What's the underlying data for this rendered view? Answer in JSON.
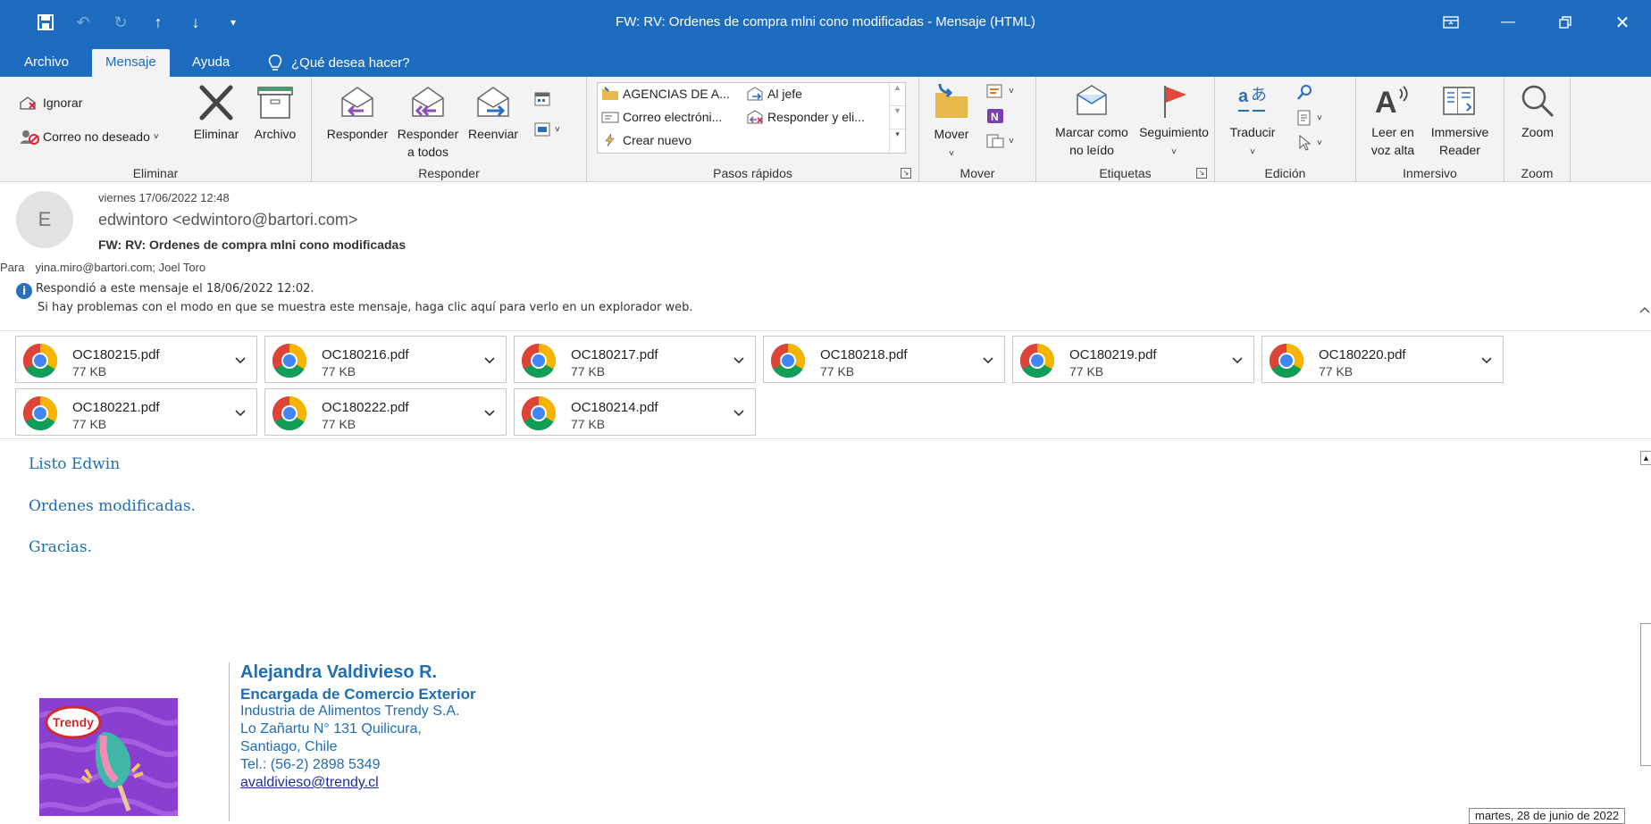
{
  "titlebar": {
    "title": "FW: RV: Ordenes de compra mlni cono  modificadas  -  Mensaje (HTML)"
  },
  "tabs": [
    {
      "label": "Archivo"
    },
    {
      "label": "Mensaje"
    },
    {
      "label": "Ayuda"
    }
  ],
  "tellme": {
    "label": "¿Qué desea hacer?"
  },
  "ribbon": {
    "eliminar": {
      "ignore": "Ignorar",
      "junk": "Correo no deseado",
      "delete": "Eliminar",
      "archive": "Archivo",
      "group": "Eliminar"
    },
    "responder": {
      "reply": "Responder",
      "reply_all_1": "Responder",
      "reply_all_2": "a todos",
      "forward": "Reenviar",
      "group": "Responder"
    },
    "quicksteps": {
      "item1": "AGENCIAS DE A...",
      "item2": "Al jefe",
      "item3": "Correo electróni...",
      "item4": "Responder y eli...",
      "item5": "Crear nuevo",
      "group": "Pasos rápidos"
    },
    "mover": {
      "move": "Mover",
      "group": "Mover"
    },
    "etiquetas": {
      "unread_1": "Marcar como",
      "unread_2": "no leído",
      "followup": "Seguimiento",
      "group": "Etiquetas"
    },
    "edicion": {
      "translate": "Traducir",
      "group": "Edición"
    },
    "inmersivo": {
      "read_1": "Leer en",
      "read_2": "voz alta",
      "immersive_1": "Immersive",
      "immersive_2": "Reader",
      "group": "Inmersivo"
    },
    "zoom": {
      "zoom": "Zoom",
      "group": "Zoom"
    }
  },
  "message": {
    "avatar_letter": "E",
    "date": "viernes 17/06/2022 12:48",
    "from": "edwintoro <edwintoro@bartori.com>",
    "subject": "FW: RV: Ordenes de compra mlni cono  modificadas",
    "to_label": "Para",
    "to": "yina.miro@bartori.com; Joel Toro",
    "info1": "Respondió a este mensaje el 18/06/2022 12:02.",
    "info2": "Si hay problemas con el modo en que se muestra este mensaje, haga clic aquí para verlo en un explorador web."
  },
  "attachments": [
    {
      "name": "OC180215.pdf",
      "size": "77 KB"
    },
    {
      "name": "OC180216.pdf",
      "size": "77 KB"
    },
    {
      "name": "OC180217.pdf",
      "size": "77 KB"
    },
    {
      "name": "OC180218.pdf",
      "size": "77 KB"
    },
    {
      "name": "OC180219.pdf",
      "size": "77 KB"
    },
    {
      "name": "OC180220.pdf",
      "size": "77 KB"
    },
    {
      "name": "OC180221.pdf",
      "size": "77 KB"
    },
    {
      "name": "OC180222.pdf",
      "size": "77 KB"
    },
    {
      "name": "OC180214.pdf",
      "size": "77 KB"
    }
  ],
  "body": {
    "line1": "Listo Edwin",
    "line2": "Ordenes modificadas.",
    "line3": "Gracias."
  },
  "signature": {
    "name": "Alejandra Valdivieso R.",
    "role": "Encargada de Comercio Exterior",
    "company": "Industria de Alimentos Trendy S.A.",
    "address": "Lo Zañartu N° 131  Quilicura,",
    "city": "Santiago, Chile",
    "phone": "Tel.: (56-2) 2898 5349",
    "email": "avaldivieso@trendy.cl",
    "logo_text": "Trendy"
  },
  "tooltip": "martes, 28 de junio de 2022"
}
